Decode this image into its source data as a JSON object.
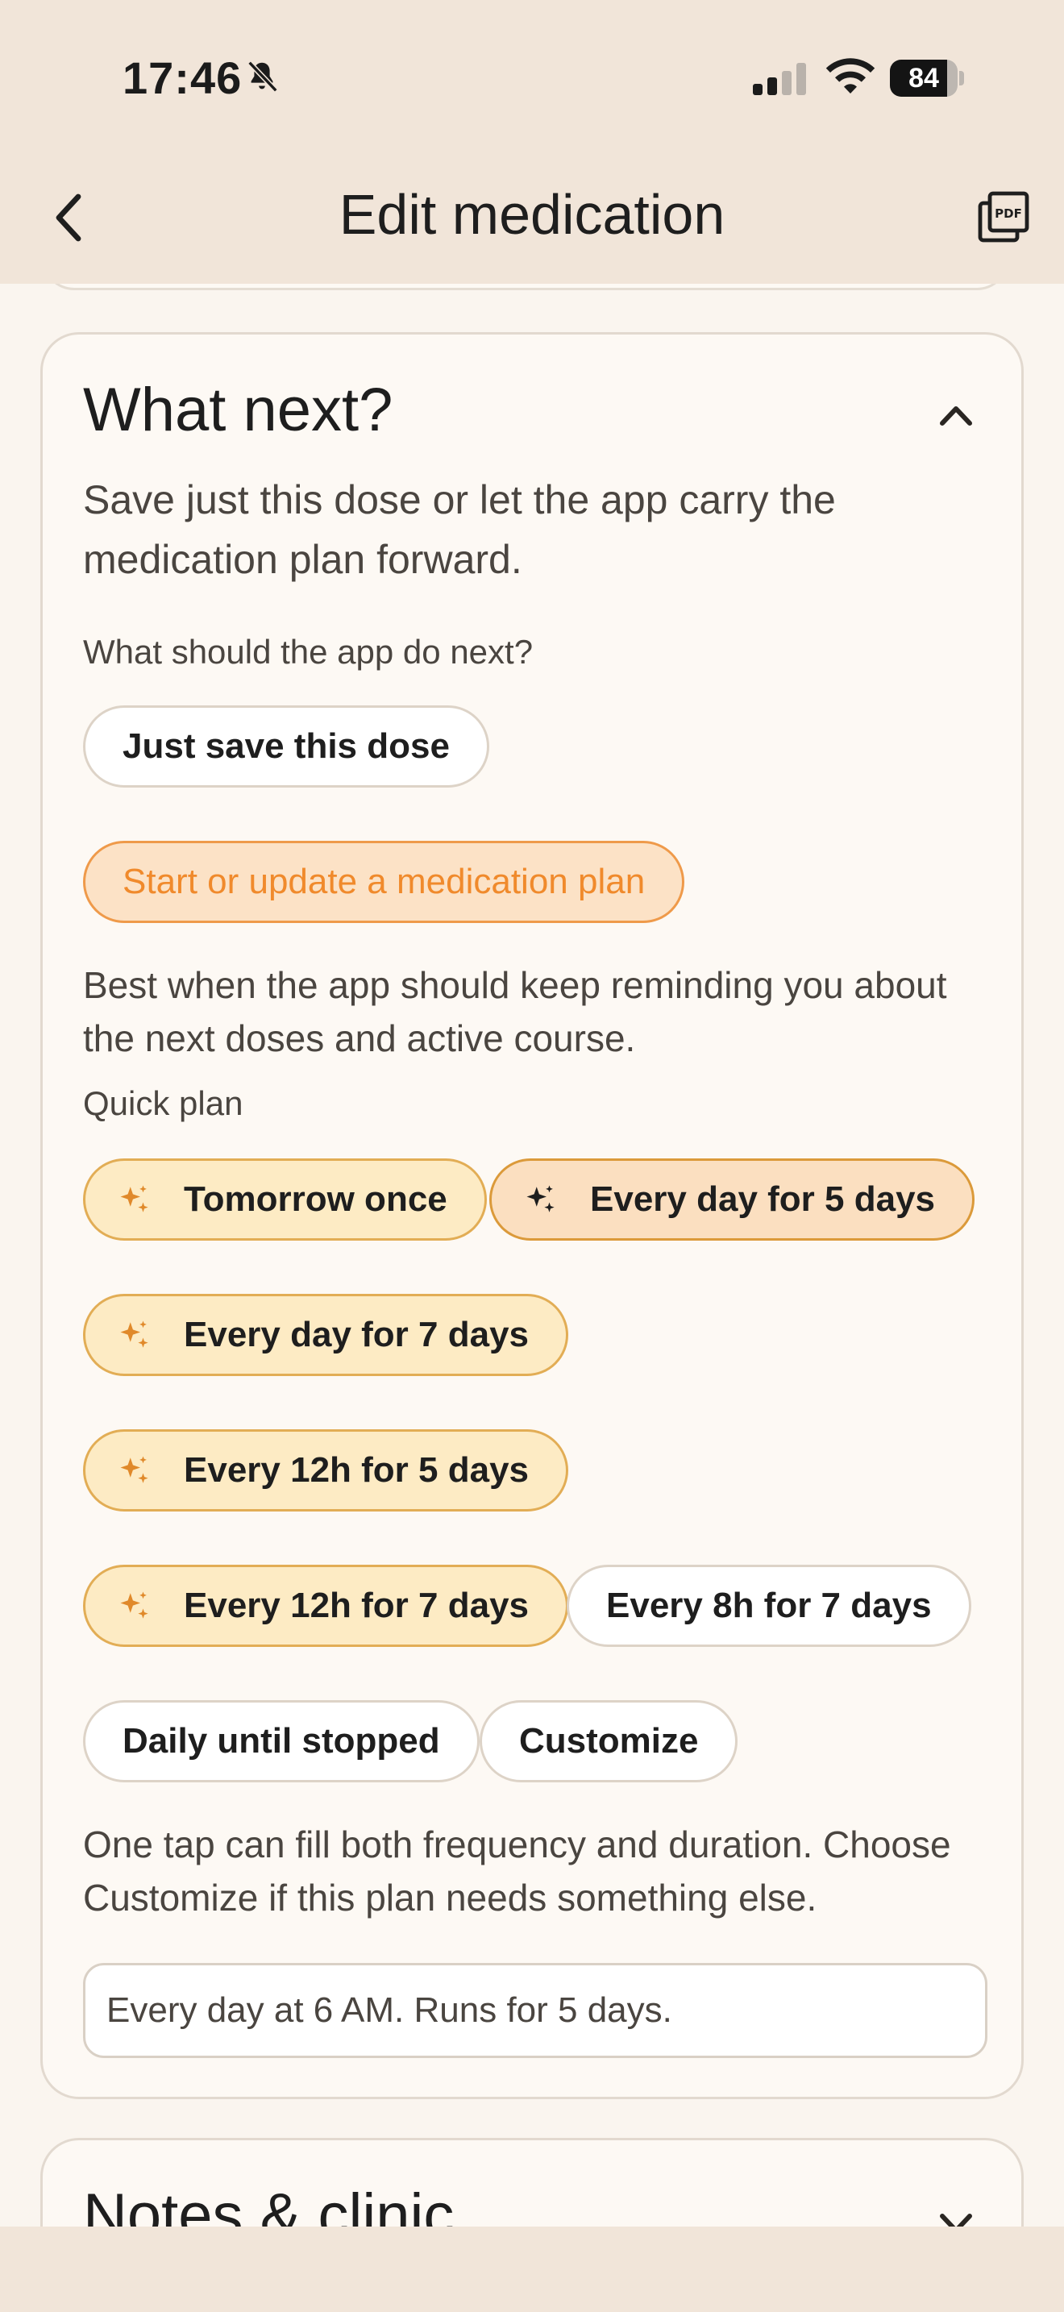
{
  "status_bar": {
    "time": "17:46",
    "battery": "84",
    "battery_level": 0.84
  },
  "header": {
    "title": "Edit medication",
    "back_icon": "chevron-left-icon",
    "pdf_icon": "pdf-icon"
  },
  "what_next": {
    "title": "What next?",
    "description": "Save just this dose or let the app carry the medication plan forward.",
    "question": "What should the app do next?",
    "options": [
      {
        "label": "Just save this dose",
        "selected": false
      },
      {
        "label": "Start or update a medication plan",
        "selected": true
      }
    ],
    "plan_description": "Best when the app should keep reminding you about the next doses and active course.",
    "quick_plan_label": "Quick plan",
    "quick_plans": [
      {
        "label": "Tomorrow once",
        "suggested": true,
        "active": false
      },
      {
        "label": "Every day for 5 days",
        "suggested": true,
        "active": true
      },
      {
        "label": "Every day for 7 days",
        "suggested": true,
        "active": false
      },
      {
        "label": "Every 12h for 5 days",
        "suggested": true,
        "active": false
      },
      {
        "label": "Every 12h for 7 days",
        "suggested": true,
        "active": false
      },
      {
        "label": "Every 8h for 7 days",
        "suggested": false,
        "active": false
      },
      {
        "label": "Daily until stopped",
        "suggested": false,
        "active": false
      },
      {
        "label": "Customize",
        "suggested": false,
        "active": false
      }
    ],
    "hint": "One tap can fill both frequency and duration. Choose Customize if this plan needs something else.",
    "summary": "Every day at 6 AM. Runs for 5 days."
  },
  "next_section": {
    "title": "Notes & clinic"
  },
  "colors": {
    "accent": "#f08a2c",
    "background": "#faf5ef",
    "header_bg": "#f1e5d9",
    "suggested_chip": "#fdebc4"
  }
}
